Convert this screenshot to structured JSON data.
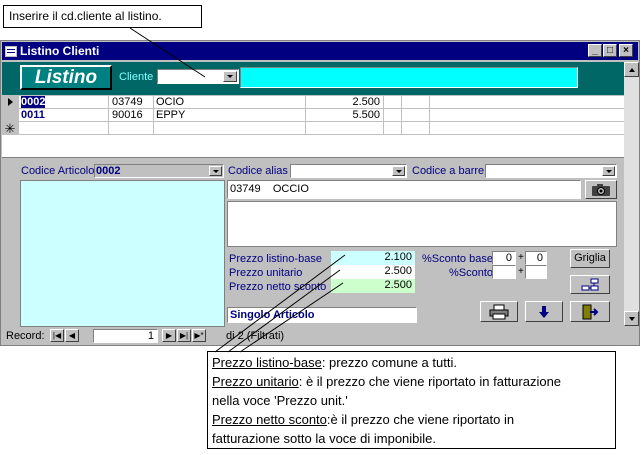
{
  "callout_top": {
    "text": "Inserire il cd.cliente al listino."
  },
  "window": {
    "title": "Listino Clienti"
  },
  "header": {
    "logo": "Listino",
    "cliente_label": "Cliente :",
    "cliente_value": "",
    "cliente_name": ""
  },
  "grid": {
    "rows": [
      {
        "codice": "0002",
        "alias": "03749",
        "descr": "OCIO",
        "prezzo": "2.500"
      },
      {
        "codice": "0011",
        "alias": "90016",
        "descr": "EPPY",
        "prezzo": "5.500"
      }
    ]
  },
  "form": {
    "codice_articolo_label": "Codice Articolo",
    "codice_articolo_value": "0002",
    "codice_alias_label": "Codice alias",
    "codice_barre_label": "Codice a barre",
    "desc_alias": "03749",
    "desc_name": "OCCIO",
    "prezzo_base_label": "Prezzo listino-base",
    "prezzo_base_value": "2.100",
    "prezzo_unit_label": "Prezzo unitario",
    "prezzo_unit_value": "2.500",
    "prezzo_netto_label": "Prezzo netto sconto",
    "prezzo_netto_value": "2.500",
    "sconto_base_label": "%Sconto base",
    "sconto_base_1": "0",
    "sconto_base_2": "0",
    "sconto_label": "%Sconto",
    "plus": "+",
    "griglia_label": "Griglia",
    "singolo_label": "Singolo Articolo"
  },
  "nav": {
    "record_label": "Record:",
    "record_value": "1",
    "total": "di 2 (Filtrati)"
  },
  "callout_bottom": {
    "line1_term": "Prezzo listino-base",
    "line1_rest": ": prezzo comune a tutti.",
    "line2_term": "Prezzo unitario",
    "line2_rest": ": è il prezzo che viene riportato in fatturazione",
    "line3": "nella voce 'Prezzo unit.'",
    "line4_term": "Prezzo netto sconto",
    "line4_rest": ":è il prezzo che viene riportato in",
    "line5": "fatturazione sotto la voce di imponibile."
  }
}
